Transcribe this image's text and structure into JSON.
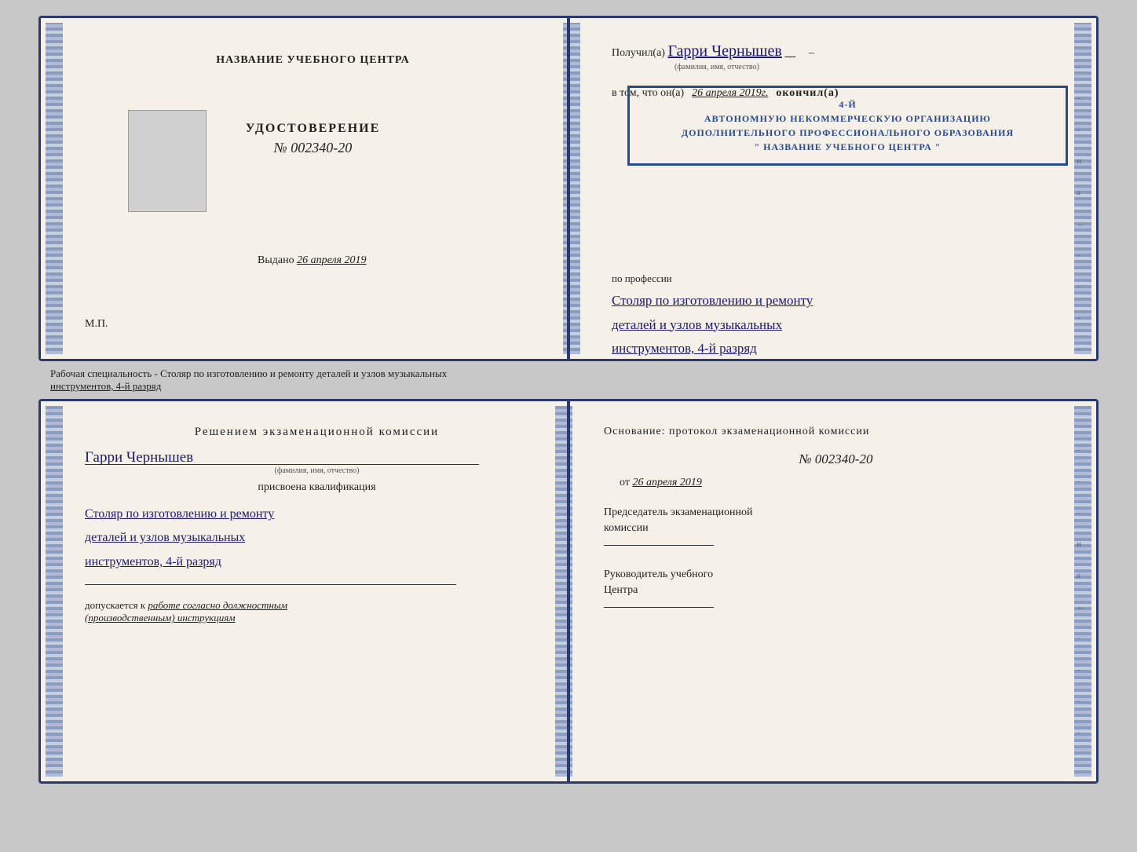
{
  "top_booklet": {
    "left": {
      "center_title": "НАЗВАНИЕ УЧЕБНОГО ЦЕНТРА",
      "udostoverenie_label": "УДОСТОВЕРЕНИЕ",
      "udostoverenie_number": "№ 002340-20",
      "vydano_label": "Выдано",
      "vydano_date": "26 апреля 2019",
      "mp": "М.П."
    },
    "right": {
      "poluchil": "Получил(а)",
      "name_handwritten": "Гарри Чернышев",
      "fio_hint": "(фамилия, имя, отчество)",
      "vtom_prefix": "в том, что он(а)",
      "vtom_date": "26 апреля 2019г.",
      "okonchil": "окончил(а)",
      "stamp_line1": "АВТОНОМНУЮ НЕКОММЕРЧЕСКУЮ ОРГАНИЗАЦИЮ",
      "stamp_line2": "ДОПОЛНИТЕЛЬНОГО ПРОФЕССИОНАЛЬНОГО ОБРАЗОВАНИЯ",
      "stamp_center": "\" НАЗВАНИЕ УЧЕБНОГО ЦЕНТРА \"",
      "razryad": "4-й",
      "po_professii": "по профессии",
      "profession_line1": "Столяр по изготовлению и ремонту",
      "profession_line2": "деталей и узлов музыкальных",
      "profession_line3": "инструментов, 4-й разряд"
    }
  },
  "separator": {
    "text": "Рабочая специальность - Столяр по изготовлению и ремонту деталей и узлов музыкальных",
    "text2": "инструментов, 4-й разряд"
  },
  "bottom_booklet": {
    "left": {
      "resheniem": "Решением  экзаменационной  комиссии",
      "name_handwritten": "Гарри Чернышев",
      "fio_hint": "(фамилия, имя, отчество)",
      "prisvoena": "присвоена квалификация",
      "profession_line1": "Столяр по изготовлению и ремонту",
      "profession_line2": "деталей и узлов музыкальных",
      "profession_line3": "инструментов, 4-й разряд",
      "dopuskaetsya": "допускается к",
      "dopusk_italic": "работе согласно должностным",
      "dopusk_italic2": "(производственным) инструкциям"
    },
    "right": {
      "osnovanie": "Основание: протокол экзаменационной  комиссии",
      "number": "№  002340-20",
      "ot_prefix": "от",
      "ot_date": "26 апреля 2019",
      "predsedatel_line1": "Председатель экзаменационной",
      "predsedatel_line2": "комиссии",
      "rukovoditel_line1": "Руководитель учебного",
      "rukovoditel_line2": "Центра"
    }
  },
  "margin_chars": {
    "items": [
      "–",
      "–",
      "–",
      "и",
      "а",
      "←",
      "–",
      "–",
      "–",
      "–"
    ]
  }
}
